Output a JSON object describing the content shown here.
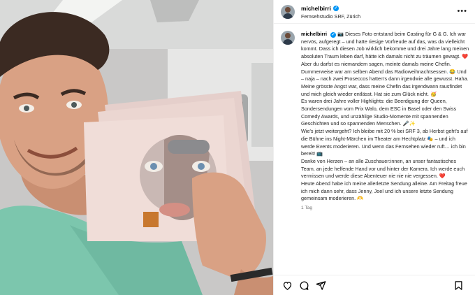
{
  "post": {
    "username": "michelbirri",
    "verified_badge": "✓",
    "location": "Fernsehstudio SRF, Zürich",
    "more_icon": "more-horizontal-icon",
    "caption_paragraphs": [
      "📷 Dieses Foto entstand beim Casting für G & G. Ich war nervös, aufgeregt – und hatte riesige Vorfreude auf das, was da vielleicht kommt. Dass ich diesen Job wirklich bekomme und drei Jahre lang meinen absoluten Traum leben darf, hätte ich damals nicht zu träumen gewagt. ❤️",
      "Aber du darfst es niemandem sagen, meinte damals meine Chefin. Dummerweise war am selben Abend das Radioweihnachtsessen. 😂 Und – naja – nach zwei Proseccos hatten's dann irgendwie alle gewusst. Haha. Meine grösste Angst war, dass meine Chefin das irgendwann rausfindet und mich gleich wieder entlässt. Hat sie zum Glück nicht. 🥳",
      "Es waren drei Jahre voller Highlights: die Beerdigung der Queen, Sondersendungen vom Prix Walo, dem ESC in Basel oder den Swiss Comedy Awards, und unzählige Studio-Momente mit spannenden Geschichten und so spannenden Menschen. 🎤✨",
      "Wie's jetzt weitergeht? Ich bleibe mit 20 % bei SRF 3, ab Herbst geht's auf die Bühne ins Night-Märchen im Theater am Hechtplatz 🎭 – und ich werde Events moderieren. Und wenn das Fernsehen wieder ruft… ich bin bereit! 📺",
      "Danke von Herzen – an alle Zuschauer:innen, an unser fantastisches Team, an jede helfende Hand vor und hinter der Kamera. Ich werde euch vermissen und werde diese Abenteuer nie nie nie vergessen. ❤️",
      "Heute Abend habe ich meine allerletzte Sendung alleine. Am Freitag freue ich mich dann sehr, dass Jenny, Joel und ich unsere letzte Sendung gemeinsam moderieren. 🫶"
    ],
    "timestamp": "1 Tag"
  },
  "actions": {
    "like_icon": "heart-icon",
    "comment_icon": "comment-icon",
    "share_icon": "share-icon",
    "save_icon": "bookmark-icon"
  },
  "colors": {
    "verified": "#0095f6",
    "divider": "#efefef",
    "shirt": "#7cc6ad"
  }
}
